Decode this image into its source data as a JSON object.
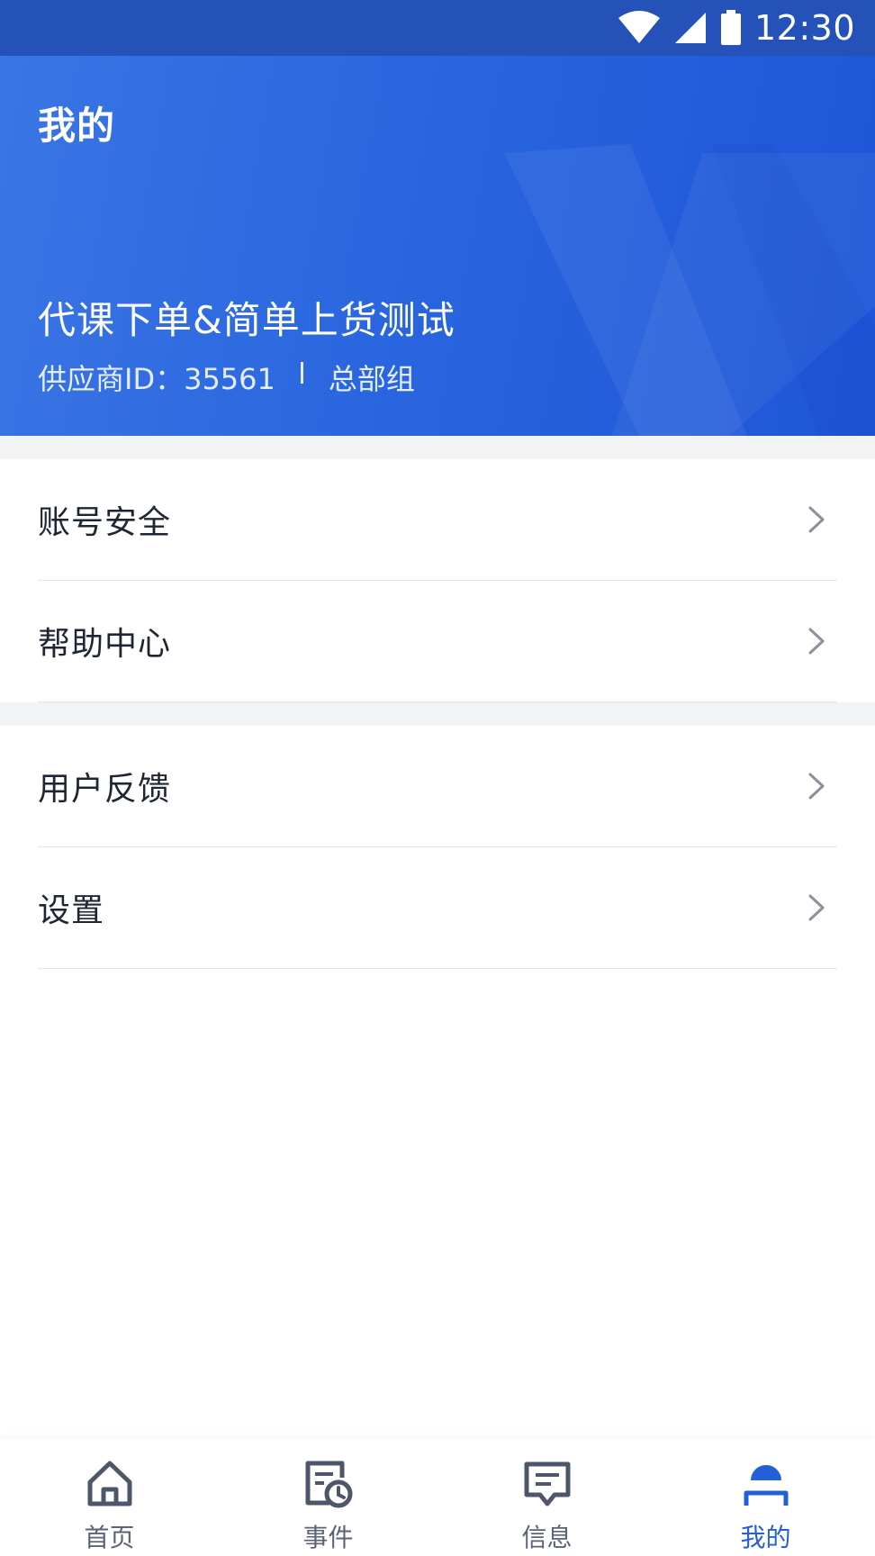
{
  "status_bar": {
    "time": "12:30",
    "icons": [
      "wifi-icon",
      "cellular-signal-icon",
      "battery-icon"
    ]
  },
  "header": {
    "title": "我的",
    "account_name": "代课下单&简单上货测试",
    "supplier_id_label": "供应商ID：35561",
    "group": "总部组",
    "colors": {
      "gradient_start": "#3a76e4",
      "gradient_end": "#1d56d8",
      "status_bar": "#2552b8"
    }
  },
  "menu": {
    "group1": [
      {
        "label": "账号安全",
        "icon": "chevron-right-icon"
      },
      {
        "label": "帮助中心",
        "icon": "chevron-right-icon"
      }
    ],
    "group2": [
      {
        "label": "用户反馈",
        "icon": "chevron-right-icon"
      },
      {
        "label": "设置",
        "icon": "chevron-right-icon"
      }
    ]
  },
  "bottom_nav": {
    "items": [
      {
        "label": "首页",
        "icon": "home-icon",
        "active": false
      },
      {
        "label": "事件",
        "icon": "event-clock-icon",
        "active": false
      },
      {
        "label": "信息",
        "icon": "message-icon",
        "active": false
      },
      {
        "label": "我的",
        "icon": "profile-icon",
        "active": true
      }
    ],
    "active_color": "#2360d8",
    "inactive_color": "#5a6377"
  }
}
